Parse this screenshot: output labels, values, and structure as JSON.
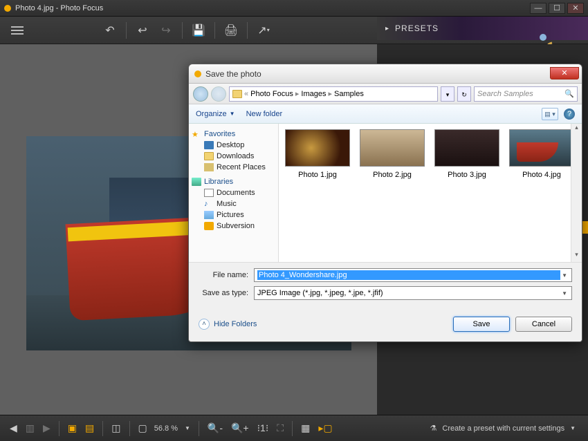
{
  "app": {
    "title": "Photo 4.jpg - Photo Focus"
  },
  "presets": {
    "label": "PRESETS"
  },
  "bottom": {
    "zoom": "56.8 %",
    "preset_btn": "Create a preset with current settings"
  },
  "dialog": {
    "title": "Save the photo",
    "breadcrumb": {
      "p1": "Photo Focus",
      "p2": "Images",
      "p3": "Samples"
    },
    "search_placeholder": "Search Samples",
    "organize": "Organize",
    "new_folder": "New folder",
    "tree": {
      "favorites": "Favorites",
      "desktop": "Desktop",
      "downloads": "Downloads",
      "recent": "Recent Places",
      "libraries": "Libraries",
      "documents": "Documents",
      "music": "Music",
      "pictures": "Pictures",
      "subversion": "Subversion"
    },
    "thumbs": [
      {
        "name": "Photo 1.jpg"
      },
      {
        "name": "Photo 2.jpg"
      },
      {
        "name": "Photo 3.jpg"
      },
      {
        "name": "Photo 4.jpg"
      }
    ],
    "file_name_label": "File name:",
    "file_name_value": "Photo 4_Wondershare.jpg",
    "save_type_label": "Save as type:",
    "save_type_value": "JPEG Image (*.jpg, *.jpeg, *.jpe, *.jfif)",
    "hide_folders": "Hide Folders",
    "save": "Save",
    "cancel": "Cancel"
  }
}
